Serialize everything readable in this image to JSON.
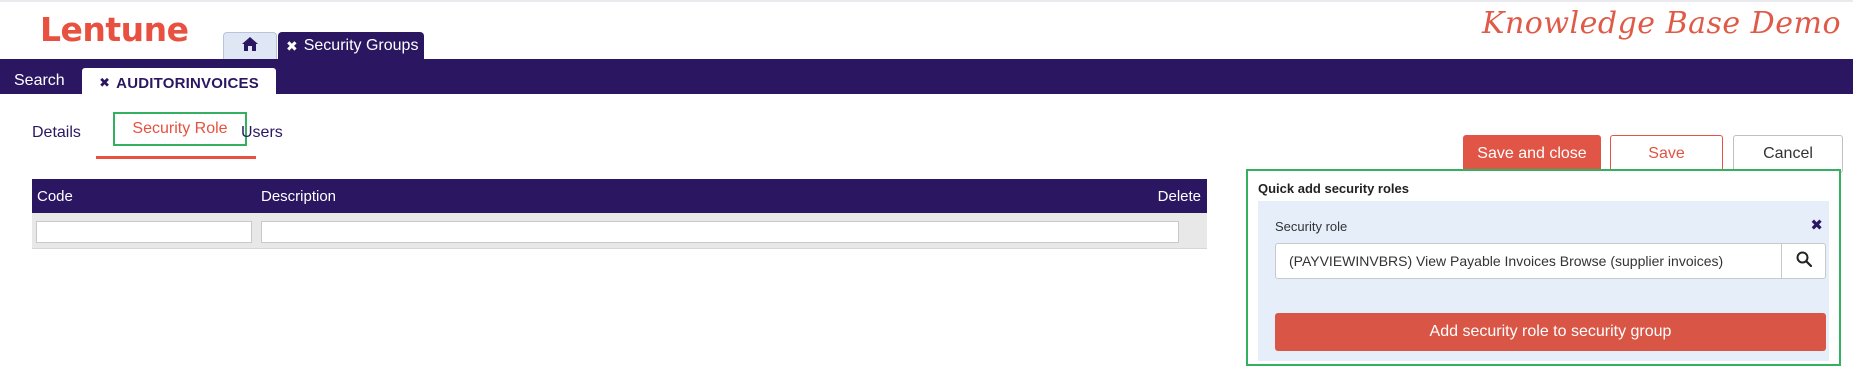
{
  "app": {
    "logo": "Lentune",
    "brand_right": "Knowledge Base Demo"
  },
  "top_tabs": {
    "home_icon": "home-icon",
    "security_groups_label": "Security Groups",
    "close_icon": "close-icon"
  },
  "navbar": {
    "search_label": "Search",
    "active_tab_label": "AUDITORINVOICES"
  },
  "subtabs": [
    {
      "label": "Details"
    },
    {
      "label": "Security Role"
    },
    {
      "label": "Users"
    }
  ],
  "grid": {
    "columns": [
      "Code",
      "Description",
      "Delete"
    ]
  },
  "actions": {
    "save_close": "Save and close",
    "save": "Save",
    "cancel": "Cancel"
  },
  "quick_add": {
    "title": "Quick add security roles",
    "field_label": "Security role",
    "field_value": "(PAYVIEWINVBRS) View Payable Invoices Browse (supplier invoices)",
    "search_icon": "search-icon",
    "add_button": "Add security role to security group"
  },
  "colors": {
    "brand_dark": "#2b1761",
    "accent": "#e8503f",
    "highlight_border": "#33b060",
    "panel_bg": "#e6eefa"
  }
}
